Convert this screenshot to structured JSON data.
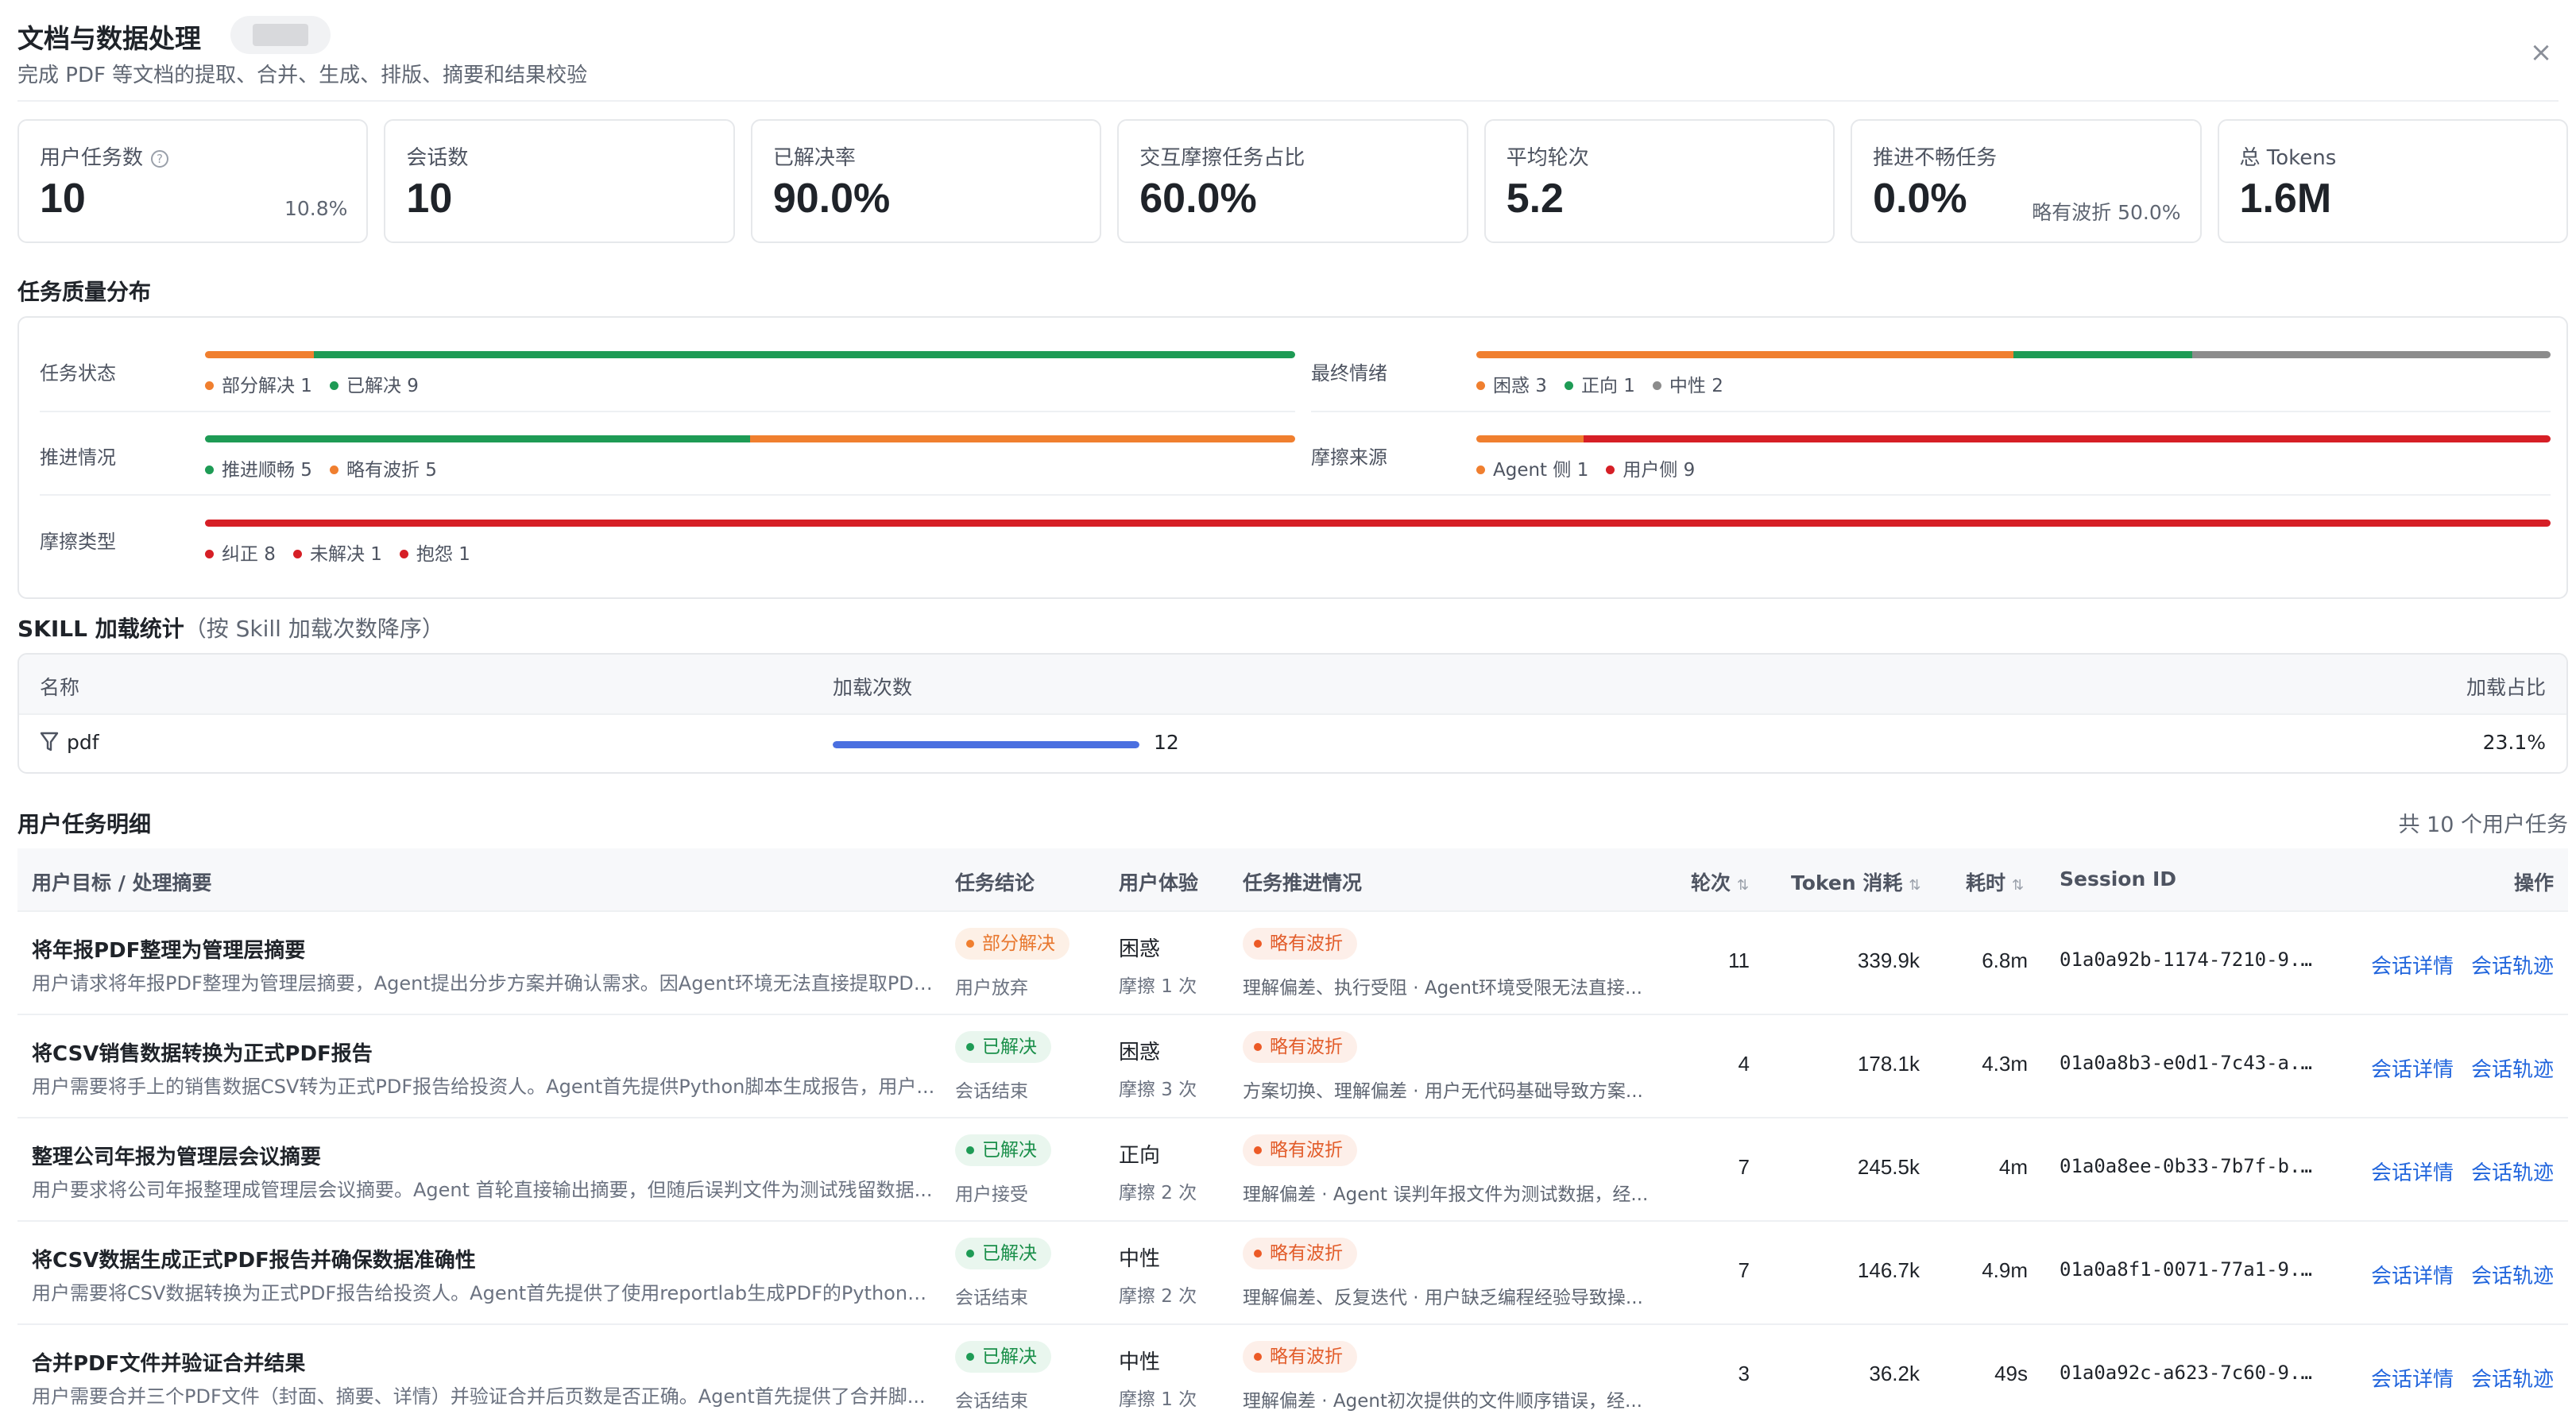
{
  "header": {
    "title": "文档与数据处理",
    "subtitle": "完成 PDF 等文档的提取、合并、生成、排版、摘要和结果校验",
    "close_icon": "×"
  },
  "metrics": [
    {
      "label": "用户任务数",
      "value": "10",
      "sub": "10.8%",
      "help": "?"
    },
    {
      "label": "会话数",
      "value": "10",
      "sub": ""
    },
    {
      "label": "已解决率",
      "value": "90.0%",
      "sub": ""
    },
    {
      "label": "交互摩擦任务占比",
      "value": "60.0%",
      "sub": ""
    },
    {
      "label": "平均轮次",
      "value": "5.2",
      "sub": ""
    },
    {
      "label": "推进不畅任务",
      "value": "0.0%",
      "sub": "略有波折 50.0%"
    },
    {
      "label": "总 Tokens",
      "value": "1.6M",
      "sub": ""
    }
  ],
  "quality": {
    "title": "任务质量分布",
    "rows": [
      {
        "label": "任务状态",
        "items": [
          {
            "name": "部分解决",
            "count": 1,
            "color": "#f07f2f"
          },
          {
            "name": "已解决",
            "count": 9,
            "color": "#1e9b55"
          }
        ]
      },
      {
        "label": "最终情绪",
        "items": [
          {
            "name": "困惑",
            "count": 3,
            "color": "#f07f2f"
          },
          {
            "name": "正向",
            "count": 1,
            "color": "#1e9b55"
          },
          {
            "name": "中性",
            "count": 2,
            "color": "#8c8c8c"
          }
        ]
      },
      {
        "label": "推进情况",
        "items": [
          {
            "name": "推进顺畅",
            "count": 5,
            "color": "#1e9b55"
          },
          {
            "name": "略有波折",
            "count": 5,
            "color": "#f07f2f"
          }
        ]
      },
      {
        "label": "摩擦来源",
        "items": [
          {
            "name": "Agent 侧",
            "count": 1,
            "color": "#f07f2f"
          },
          {
            "name": "用户侧",
            "count": 9,
            "color": "#d61f26"
          }
        ]
      },
      {
        "label": "摩擦类型",
        "items": [
          {
            "name": "纠正",
            "count": 8,
            "color": "#d61f26"
          },
          {
            "name": "未解决",
            "count": 1,
            "color": "#d61f26"
          },
          {
            "name": "抱怨",
            "count": 1,
            "color": "#d61f26"
          }
        ]
      }
    ]
  },
  "skill": {
    "title": "SKILL 加载统计",
    "note": "（按 Skill 加载次数降序）",
    "headers": {
      "name": "名称",
      "count": "加载次数",
      "ratio": "加载占比"
    },
    "rows": [
      {
        "name": "pdf",
        "count": "12",
        "ratio": "23.1%",
        "fill": 1.0,
        "icon": "filter-icon"
      }
    ]
  },
  "tasks": {
    "title": "用户任务明细",
    "total": "共 10 个用户任务",
    "headers": {
      "goal": "用户目标 / 处理摘要",
      "conclusion": "任务结论",
      "experience": "用户体验",
      "progress": "任务推进情况",
      "rounds": "轮次",
      "tokens": "Token 消耗",
      "duration": "耗时",
      "session": "Session ID",
      "actions": "操作"
    },
    "link_detail": "会话详情",
    "link_trace": "会话轨迹",
    "rows": [
      {
        "title": "将年报PDF整理为管理层摘要",
        "desc": "用户请求将年报PDF整理为管理层摘要，Agent提出分步方案并确认需求。因Agent环境无法直接提取PDF...",
        "conclusion": "部分解决",
        "conclusion_type": "orange",
        "end": "用户放弃",
        "ux": "困惑",
        "friction": "摩擦 1 次",
        "progress": "略有波折",
        "reason": "理解偏差、执行受阻 · Agent环境受限无法直接...",
        "rounds": "11",
        "tokens": "339.9k",
        "duration": "6.8m",
        "session": "01a0a92b-1174-7210-9..."
      },
      {
        "title": "将CSV销售数据转换为正式PDF报告",
        "desc": "用户需要将手上的销售数据CSV转为正式PDF报告给投资人。Agent首先提供Python脚本生成报告，用户...",
        "conclusion": "已解决",
        "conclusion_type": "green",
        "end": "会话结束",
        "ux": "困惑",
        "friction": "摩擦 3 次",
        "progress": "略有波折",
        "reason": "方案切换、理解偏差 · 用户无代码基础导致方案...",
        "rounds": "4",
        "tokens": "178.1k",
        "duration": "4.3m",
        "session": "01a0a8b3-e0d1-7c43-a..."
      },
      {
        "title": "整理公司年报为管理层会议摘要",
        "desc": "用户要求将公司年报整理成管理层会议摘要。Agent 首轮直接输出摘要，但随后误判文件为测试残留数据...",
        "conclusion": "已解决",
        "conclusion_type": "green",
        "end": "用户接受",
        "ux": "正向",
        "friction": "摩擦 2 次",
        "progress": "略有波折",
        "reason": "理解偏差 · Agent 误判年报文件为测试数据，经...",
        "rounds": "7",
        "tokens": "245.5k",
        "duration": "4m",
        "session": "01a0a8ee-0b33-7b7f-b..."
      },
      {
        "title": "将CSV数据生成正式PDF报告并确保数据准确性",
        "desc": "用户需要将CSV数据转换为正式PDF报告给投资人。Agent首先提供了使用reportlab生成PDF的Python脚...",
        "conclusion": "已解决",
        "conclusion_type": "green",
        "end": "会话结束",
        "ux": "中性",
        "friction": "摩擦 2 次",
        "progress": "略有波折",
        "reason": "理解偏差、反复迭代 · 用户缺乏编程经验导致操...",
        "rounds": "7",
        "tokens": "146.7k",
        "duration": "4.9m",
        "session": "01a0a8f1-0071-77a1-9..."
      },
      {
        "title": "合并PDF文件并验证合并结果",
        "desc": "用户需要合并三个PDF文件（封面、摘要、详情）并验证合并后页数是否正确。Agent首先提供了合并脚...",
        "conclusion": "已解决",
        "conclusion_type": "green",
        "end": "会话结束",
        "ux": "中性",
        "friction": "摩擦 1 次",
        "progress": "略有波折",
        "reason": "理解偏差 · Agent初次提供的文件顺序错误，经...",
        "rounds": "3",
        "tokens": "36.2k",
        "duration": "49s",
        "session": "01a0a92c-a623-7c60-9..."
      }
    ]
  },
  "colors": {
    "accent": "#2266dd",
    "green": "#1e9b55",
    "orange": "#f07f2f",
    "red": "#d61f26",
    "gray": "#8c8c8c",
    "skill_bar": "#4a6fe0"
  }
}
